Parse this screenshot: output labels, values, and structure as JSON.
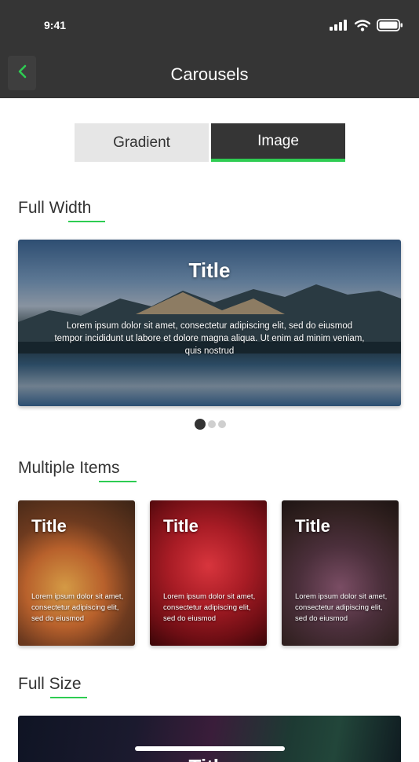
{
  "status_bar": {
    "time": "9:41"
  },
  "nav": {
    "title": "Carousels"
  },
  "tabs": [
    {
      "label": "Gradient",
      "active": false
    },
    {
      "label": "Image",
      "active": true
    }
  ],
  "sections": {
    "full_width": {
      "heading": "Full Width",
      "card": {
        "title": "Title",
        "text": "Lorem ipsum dolor sit amet, consectetur adipiscing elit, sed do eiusmod tempor incididunt ut labore et dolore magna aliqua. Ut enim ad minim veniam, quis nostrud"
      },
      "pagination": {
        "count": 3,
        "active_index": 0
      }
    },
    "multiple_items": {
      "heading": "Multiple Items",
      "cards": [
        {
          "title": "Title",
          "text": "Lorem ipsum dolor sit amet, consectetur adipiscing elit, sed do eiusmod"
        },
        {
          "title": "Title",
          "text": "Lorem ipsum dolor sit amet, consectetur adipiscing elit, sed do eiusmod"
        },
        {
          "title": "Title",
          "text": "Lorem ipsum dolor sit amet, consectetur adipiscing elit, sed do eiusmod"
        }
      ]
    },
    "full_size": {
      "heading": "Full Size",
      "card": {
        "title": "Title"
      }
    }
  },
  "colors": {
    "header_bg": "#353535",
    "accent": "#2ecc52",
    "tab_inactive_bg": "#e6e6e6"
  },
  "icons": {
    "back": "chevron-left-icon",
    "signal": "cellular-signal-icon",
    "wifi": "wifi-icon",
    "battery": "battery-icon"
  }
}
